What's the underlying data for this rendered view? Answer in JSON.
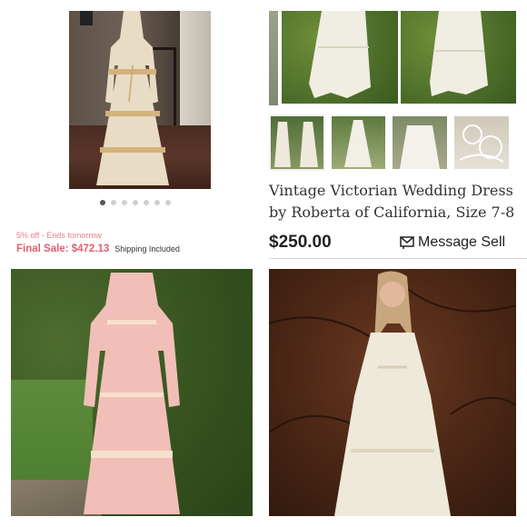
{
  "listing_title": "Vintage Victorian Wedding Dress by Roberta of California, Size 7-8",
  "price": "$250.00",
  "message_label": "Message Sell",
  "promo_text": "5% off - Ends tomorrow",
  "final_sale": "Final Sale: $472.13",
  "shipping_note": "Shipping Included",
  "carousel": {
    "count": 7,
    "active_index": 0
  },
  "colors": {
    "promo": "#e8808a",
    "final_sale": "#e4606e"
  },
  "icons": {
    "message": "envelope-icon"
  }
}
